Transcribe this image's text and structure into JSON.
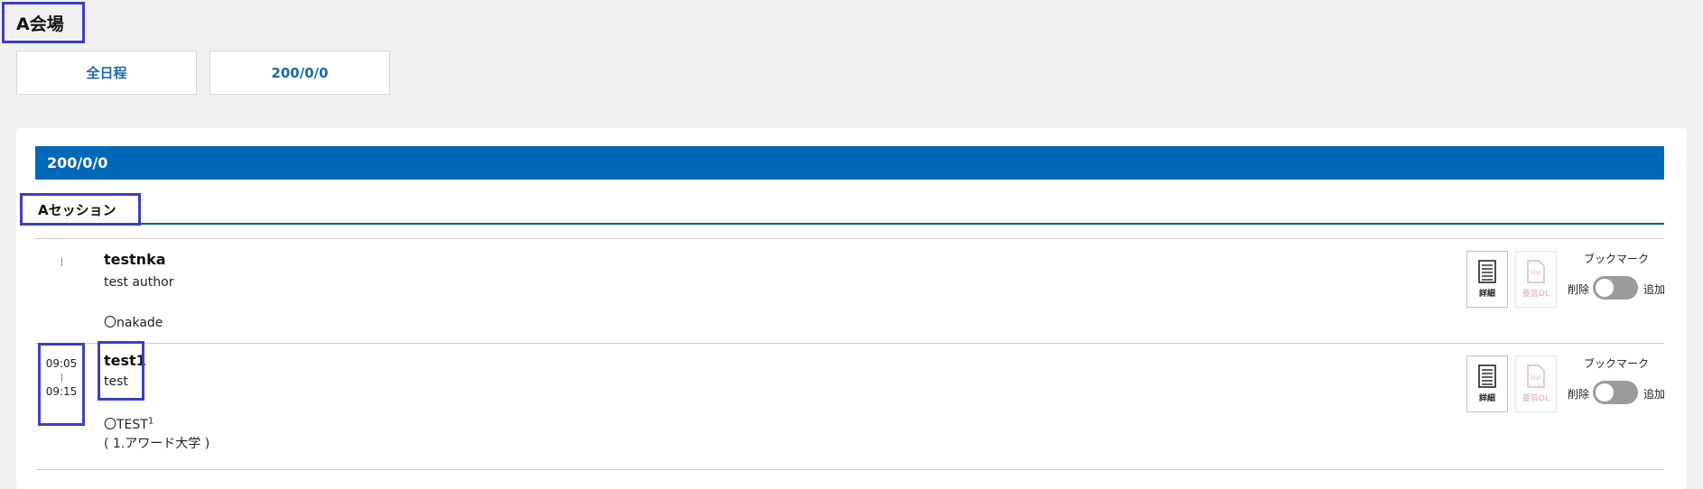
{
  "venue": {
    "title": "A会場"
  },
  "date_tabs": [
    {
      "label": "全日程"
    },
    {
      "label": "200/0/0"
    }
  ],
  "schedule": {
    "date": "200/0/0",
    "session": "Aセッション",
    "items": [
      {
        "start": "",
        "end": "",
        "title": "testnka",
        "author": "test author",
        "presenter_mark": "〇",
        "presenter": "nakade",
        "superscript": "",
        "affiliation": ""
      },
      {
        "start": "09:05",
        "end": "09:15",
        "title": "test1",
        "author": "test",
        "presenter_mark": "〇",
        "presenter": "TEST",
        "superscript": "1",
        "affiliation": "( 1.アワード大学 )"
      }
    ]
  },
  "actions": {
    "detail_label": "詳細",
    "pdf_label": "要旨DL",
    "pdf_icon_text": "PDF",
    "bookmark_label": "ブックマーク",
    "remove_label": "削除",
    "add_label": "追加"
  },
  "colors": {
    "date_bar": "#0068b6",
    "tab_text": "#1f6aa8",
    "highlight": "#3b3fc4"
  },
  "icons": [
    "document-list-icon",
    "pdf-file-icon",
    "toggle-switch"
  ]
}
